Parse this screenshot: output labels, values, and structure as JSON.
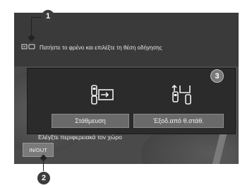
{
  "notice": {
    "text": "Πατήστε το φρένο και επιλέξτε τη θέση οδήγησης",
    "icon": "car-brake-warning-icon"
  },
  "parking_panel": {
    "park_button_label": "Στάθμευση",
    "exit_button_label": "Έξοδ.από θ.στάθ.",
    "park_icon": "parallel-park-in-icon",
    "exit_icon": "parallel-park-out-icon"
  },
  "check_surroundings_text": "Ελέγξτε περιφερειακά τον χώρο",
  "inout_button_label": "IN/OUT",
  "callouts": {
    "one": "1",
    "two": "2",
    "three": "3"
  }
}
